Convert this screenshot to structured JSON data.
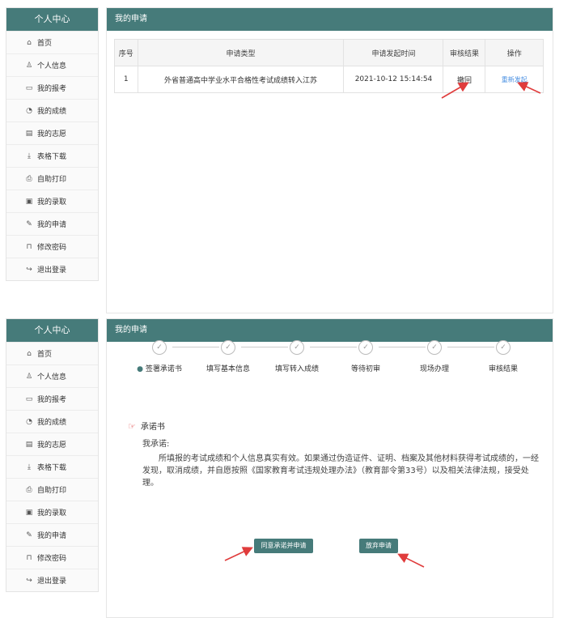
{
  "top": {
    "sidebar": {
      "title": "个人中心",
      "items": [
        {
          "label": "首页",
          "icon": "home-icon"
        },
        {
          "label": "个人信息",
          "icon": "user-icon"
        },
        {
          "label": "我的报考",
          "icon": "id-card-icon"
        },
        {
          "label": "我的成绩",
          "icon": "chart-icon"
        },
        {
          "label": "我的志愿",
          "icon": "document-icon"
        },
        {
          "label": "表格下载",
          "icon": "download-icon"
        },
        {
          "label": "自助打印",
          "icon": "print-icon"
        },
        {
          "label": "我的录取",
          "icon": "calendar-icon"
        },
        {
          "label": "我的申请",
          "icon": "edit-icon"
        },
        {
          "label": "修改密码",
          "icon": "lock-icon"
        },
        {
          "label": "退出登录",
          "icon": "logout-icon"
        }
      ]
    },
    "main": {
      "title": "我的申请",
      "columns": [
        "序号",
        "申请类型",
        "申请发起时间",
        "审核结果",
        "操作"
      ],
      "rows": [
        {
          "no": "1",
          "type": "外省普通高中学业水平合格性考试成绩转入江苏",
          "time": "2021-10-12 15:14:54",
          "result": "撤回",
          "action": "重新发起"
        }
      ]
    }
  },
  "bottom": {
    "sidebar": {
      "title": "个人中心",
      "items": [
        {
          "label": "首页",
          "icon": "home-icon"
        },
        {
          "label": "个人信息",
          "icon": "user-icon"
        },
        {
          "label": "我的报考",
          "icon": "id-card-icon"
        },
        {
          "label": "我的成绩",
          "icon": "chart-icon"
        },
        {
          "label": "我的志愿",
          "icon": "document-icon"
        },
        {
          "label": "表格下载",
          "icon": "download-icon"
        },
        {
          "label": "自助打印",
          "icon": "print-icon"
        },
        {
          "label": "我的录取",
          "icon": "calendar-icon"
        },
        {
          "label": "我的申请",
          "icon": "edit-icon"
        },
        {
          "label": "修改密码",
          "icon": "lock-icon"
        },
        {
          "label": "退出登录",
          "icon": "logout-icon"
        }
      ]
    },
    "main": {
      "title": "我的申请",
      "steps": [
        "签署承诺书",
        "填写基本信息",
        "填写转入成绩",
        "等待初审",
        "现场办理",
        "审核结果"
      ],
      "pledge_title": "承诺书",
      "pledge_sub": "我承诺:",
      "pledge_body": "所填报的考试成绩和个人信息真实有效。如果通过伪造证件、证明、档案及其他材料获得考试成绩的，一经发现，取消成绩，并自愿按照《国家教育考试违规处理办法》（教育部令第33号）以及相关法律法规，接受处理。",
      "agree_button": "同意承诺并申请",
      "abandon_button": "放弃申请"
    }
  },
  "colors": {
    "header": "#467b7a",
    "link": "#4a90e2",
    "arrow": "#e03c3c"
  }
}
